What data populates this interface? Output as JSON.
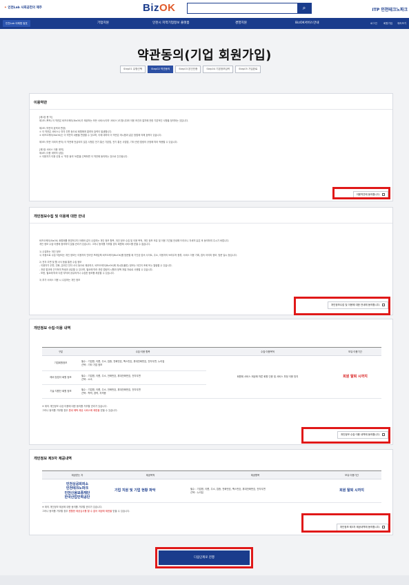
{
  "header": {
    "left_logo": "인천Lab 사회공헌의 제주",
    "brand_biz": "Biz",
    "brand_ok": "OK",
    "search_placeholder": "",
    "search_icon": "search-icon",
    "right_logo": "ITP 인천테크노파크"
  },
  "nav": {
    "badge": "인천Lab 이해법 발표",
    "items": [
      "기업지원",
      "인천시 지역기업정보 플랫폼",
      "경영지원",
      "BizOK서비스안내"
    ],
    "utils": [
      "로그인",
      "회원가입",
      "재속보기"
    ]
  },
  "page": {
    "title": "약관동의(기업 회원가입)",
    "steps": [
      "Step01 유형선택",
      "Step02 약관동의",
      "Step03 본인인증",
      "Step04 기본정보입력",
      "Step05 가입완료"
    ],
    "active_step": 1
  },
  "terms": {
    "title": "이용약관",
    "lines": [
      "[제1장 총 칙]",
      "제1조 (목적) 이 약관은 비즈오케이(BizOK)가 제공하는 모든 서비스(이하 '서비스')의 합니다와 이용 조건과 절차에 관한 기본적인 사항을 정의하는 것입니다.",
      "",
      "제2조 (약관의 효력과 변경)",
      "① 이 약관은 서비스나 전자 우편 등으로 회원에게 알려야 효력이 발생합니다.",
      "② 비즈오케이(BizOK)는 이 약관의 내용을 변경할 수 있으며, 이에 대하여 이 약관은 게시함과 같은 방법에 의해 효력이 있습니다.",
      "",
      "제3조 (약관 이외의 준칙) 이 약관에 언급되지 않은 사항은 전기 통신 기본법, 전기 통신 사업법, 기타 관련 법령의 규정에 따라 적용할 수 있습니다.",
      "",
      "[제2장 서비스 이용 계약]",
      "제4조 (이용 계약의 성립)",
      "① 이용자가 이용 신청 시 '약관 동의' 버튼을 선택하면 이 약관에 동의하는 것으로 간주됩니다."
    ],
    "agree_label": "이용약관에 동의합니다."
  },
  "privacy_guide": {
    "title": "개인정보수집 및 이용에 대한 안내",
    "lines": [
      "비즈오케이(BizOK) 회원제를 운영하고자 아래와 같이 수집하는 개인 정보 항목, 개인 정보 수집 및 이용 목적, 개인 정보 보유 및 이용 기간을 안내해 드리오니 자세히 읽은 후 동의하여 주시기 바랍니다.",
      "개인 정보 수집·이용에 동의하지 않을 권리가 있습니다. 그러나 동의를 거부할 경우 회원제 서비스를 받을 수 없습니다.",
      "",
      "1) 수집하는 개인 정보",
      "1) 자동으로 수집 저장되는 개인 정보는 이용자의 인터넷 프레임웍 비즈오케이(BizOK)를 방문할 때 기인된 접속 사이트, 주소, 이용자의 브라우저 종류, 서비스 이용 기록, 접속 아이피 정보, 방문 일시 등입니다.",
      "",
      "2) 전자 우편 및 웹 서식 등을 통한 수집 정보",
      "- 이용자가 우편, 전화, 온라인 전자 서식 등으로 제공하고, 비즈오케이(BizOK)에 게시한(올린) 정보는 아인이 조회 또는 열람할 수 있습니다.",
      "- 관련 법규에 근거하여 학생과 공유할 수 있으며, 필요에 따라 관련 법령의 시행과 정책 개발 자료로 사용할 수 있습니다.",
      "- 또한, 필요에 따라 다른 부처와 공유하거나 수집한 정보를 제공할 수 있습니다.",
      "",
      "3) 부가 서비스 이용 시 수집하는 개인 정보"
    ],
    "agree_label": "개인정보수집 및 이용에 대한 안내에 동의합니다."
  },
  "collection": {
    "title": "개인정보 수집·이용 내역",
    "headers": [
      "구분",
      "수집·이용 항목",
      "수집·이용목적",
      "보유·이용기간"
    ],
    "rows": [
      {
        "type": "기업회원정보",
        "items": "필수 : 기업명, 이름, 주소, 업종, 전화번호, 팩스번호, 휴대전화번호, 전자우편, 누리집\n선택 : 기타 기업 정보"
      },
      {
        "type": "예비 창업자 회원 정보",
        "items": "필수 : 기업명, 이름, 주소, 전화번호, 휴대전화번호, 전자우편\n선택 : 소속"
      },
      {
        "type": "기술 지원단 회원 정보",
        "items": "필수 : 기업명, 이름, 주소, 전화번호, 휴대전화번호, 전자우편\n선택 : 학력, 경력, 자격증"
      }
    ],
    "purpose": "회원제 서비스 제공에 따른 회원 인증 및 서비스 부정 이용 방지",
    "period": "회원 탈퇴 시까지",
    "note1": "※ 위의 개인정보 수집·이용에 대한 동의를 거부할 권리가 있습니다.",
    "note2_prefix": "그러나 동의를 거부할 경우 ",
    "note2_highlight": "원내 혜택 제공 서비스에 제한을",
    "note2_suffix": " 받을 수 있습니다.",
    "agree_label": "개인정보 수집·이용 내역에 동의합니다."
  },
  "third_party": {
    "title": "개인정보 제3자 제공내역",
    "headers": [
      "제공받는 자",
      "제공목적",
      "제공항목",
      "보유·이용기간"
    ],
    "recipients": [
      "인천상공회의소",
      "인천테크노파크",
      "인천신용보증재단",
      "한국산업인력공단"
    ],
    "purpose": "기업 지원 및 기업 현황 파악",
    "items": "필수 : 기업명, 이름, 주소, 업종, 전화번호, 팩스번호, 휴대전화번호, 전자우편\n선택 : 누리집",
    "period": "회원 탈퇴 시까지",
    "note1": "※ 위의 개인정보 제공에 대한 동의를 거부할 권리가 있습니다.",
    "note2_prefix": "그러나 동의를 거부할 경우 ",
    "note2_highlight": "원활한 제공심사를 할 수 없어 제공에 제한을",
    "note2_suffix": " 받을 수 있습니다.",
    "agree_label": "개인정보 제3자 제공내역에 동의합니다."
  },
  "footer": {
    "next_label": "다음단계로 진행"
  },
  "colors": {
    "brand": "#1a3c8c",
    "accent": "#e05a2a",
    "highlight_frame": "#e01818"
  }
}
